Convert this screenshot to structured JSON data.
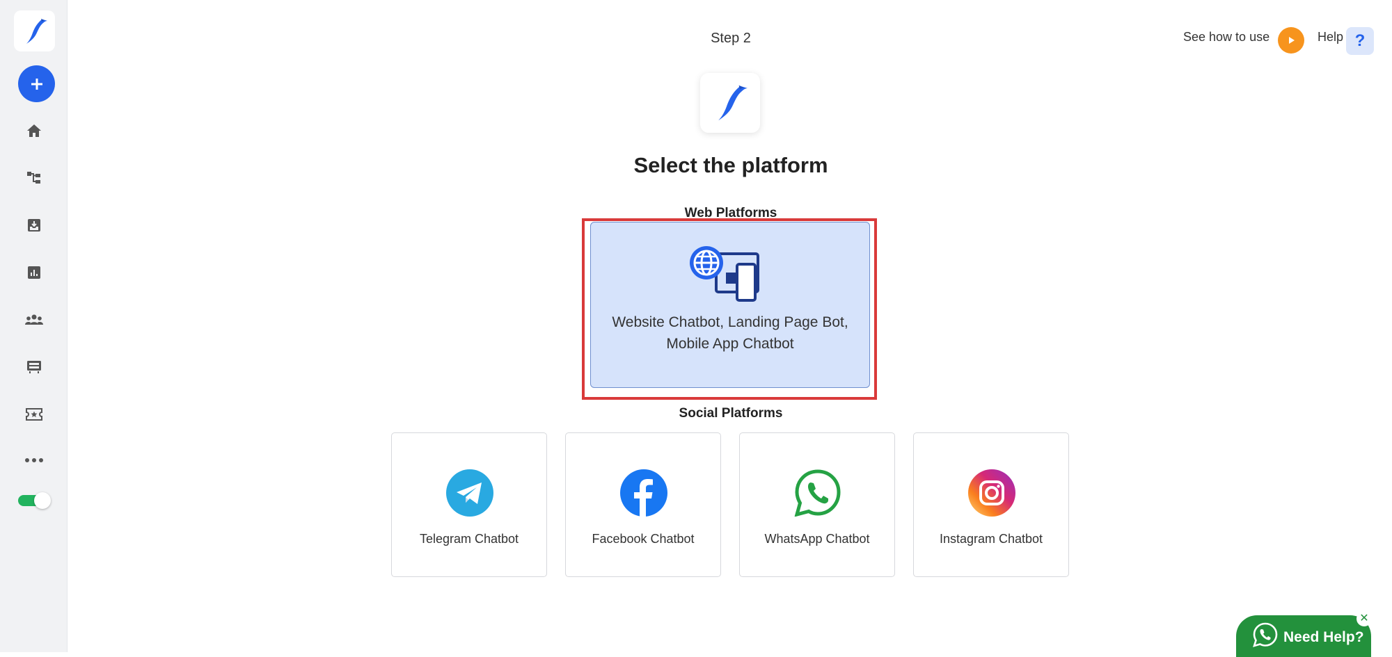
{
  "header": {
    "step_label": "Step 2",
    "see_how_label": "See how to use",
    "help_label": "Help",
    "help_icon_glyph": "?"
  },
  "sidebar": {
    "items": [
      {
        "icon": "home-icon"
      },
      {
        "icon": "flow-icon"
      },
      {
        "icon": "inbox-icon"
      },
      {
        "icon": "analytics-icon"
      },
      {
        "icon": "users-icon"
      },
      {
        "icon": "templates-icon"
      },
      {
        "icon": "ticket-icon"
      },
      {
        "icon": "more-icon"
      }
    ],
    "toggle_on": true
  },
  "main": {
    "title": "Select the platform",
    "web_heading": "Web Platforms",
    "web_card_label_line1": "Website Chatbot, Landing Page Bot,",
    "web_card_label_line2": "Mobile App Chatbot",
    "social_heading": "Social Platforms",
    "social_cards": [
      {
        "label": "Telegram Chatbot",
        "icon": "telegram-icon"
      },
      {
        "label": "Facebook Chatbot",
        "icon": "facebook-icon"
      },
      {
        "label": "WhatsApp Chatbot",
        "icon": "whatsapp-icon"
      },
      {
        "label": "Instagram Chatbot",
        "icon": "instagram-icon"
      }
    ]
  },
  "widget": {
    "need_help_label": "Need Help?",
    "close_glyph": "✕"
  },
  "colors": {
    "accent": "#2563eb",
    "orange": "#f7941d",
    "green": "#23913c",
    "highlight": "#d93a3a",
    "selected_card": "#d6e3fb"
  }
}
